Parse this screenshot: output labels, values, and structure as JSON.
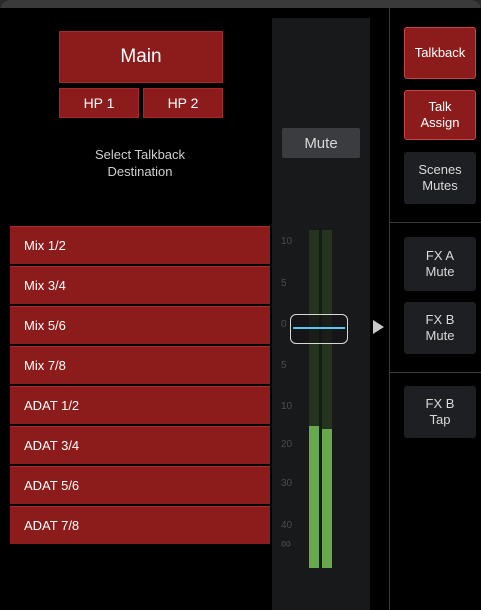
{
  "destination": {
    "main_label": "Main",
    "hp1_label": "HP 1",
    "hp2_label": "HP 2",
    "select_label_line1": "Select Talkback",
    "select_label_line2": "Destination",
    "items": [
      "Mix 1/2",
      "Mix 3/4",
      "Mix 5/6",
      "Mix 7/8",
      "ADAT 1/2",
      "ADAT 3/4",
      "ADAT 5/6",
      "ADAT 7/8"
    ]
  },
  "strip": {
    "mute_label": "Mute",
    "scale": [
      "10",
      "5",
      "0",
      "5",
      "10",
      "20",
      "30",
      "40",
      "∞"
    ],
    "meter_levels": [
      0.42,
      0.41
    ]
  },
  "side": {
    "talkback_label": "Talkback",
    "talk_assign_line1": "Talk",
    "talk_assign_line2": "Assign",
    "scenes_line1": "Scenes",
    "scenes_line2": "Mutes",
    "fxa_line1": "FX A",
    "fxa_line2": "Mute",
    "fxb_mute_line1": "FX B",
    "fxb_mute_line2": "Mute",
    "fxb_tap_line1": "FX B",
    "fxb_tap_line2": "Tap"
  },
  "colors": {
    "accent_red": "#8c1c1c",
    "meter_green": "#67a94c",
    "fader_line": "#59c7ea"
  }
}
